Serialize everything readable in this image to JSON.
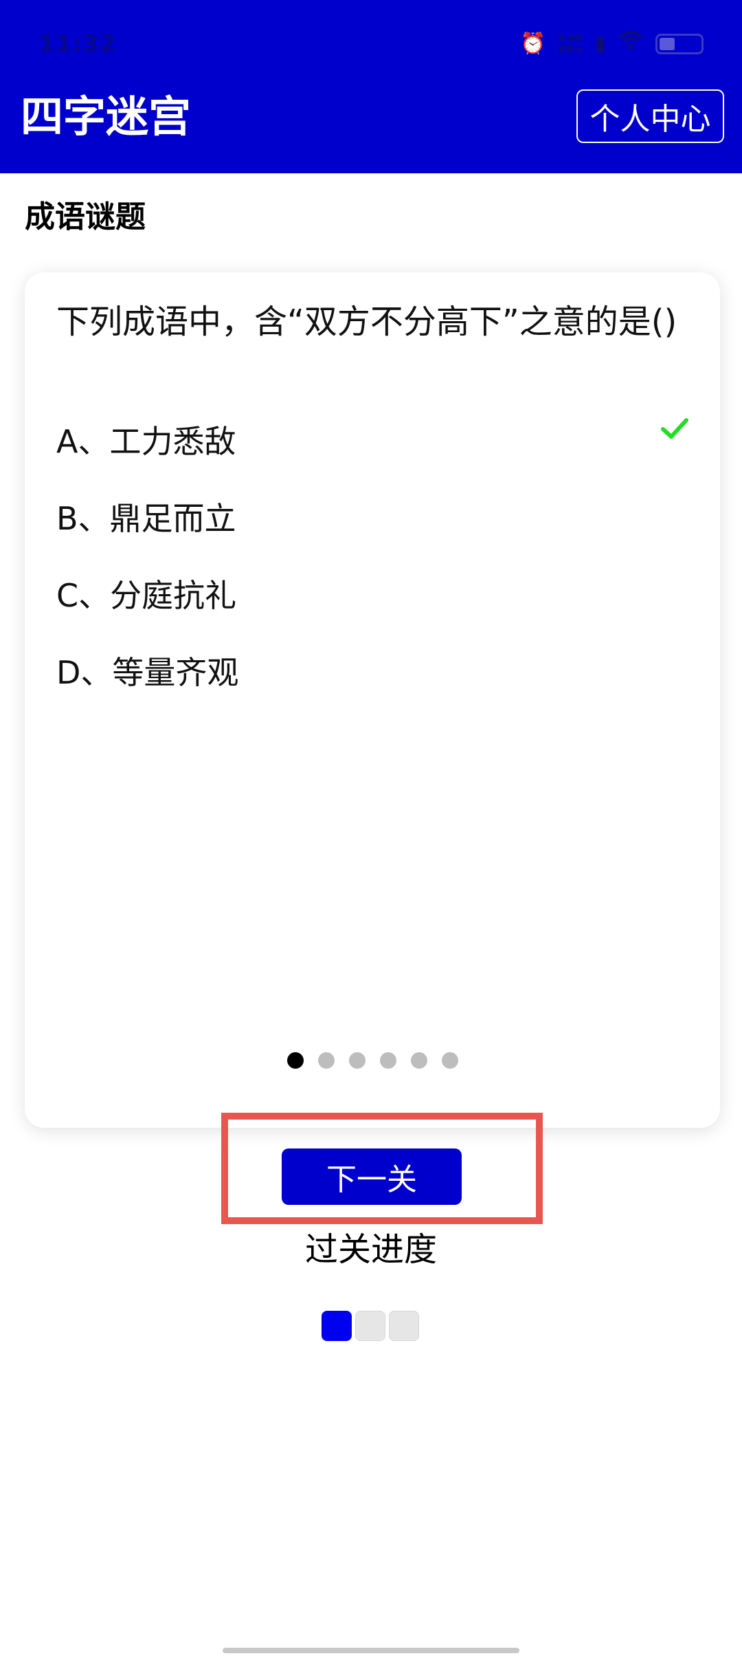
{
  "status_bar": {
    "time": "11:32",
    "net_speed": "0.90",
    "net_unit": "KB/s"
  },
  "header": {
    "title": "四字迷宫",
    "profile_label": "个人中心"
  },
  "section": {
    "title": "成语谜题"
  },
  "quiz": {
    "question": "下列成语中，含“双方不分高下”之意的是()",
    "options": [
      {
        "label": "A、工力悉敌",
        "correct": true
      },
      {
        "label": "B、鼎足而立"
      },
      {
        "label": "C、分庭抗礼"
      },
      {
        "label": "D、等量齐观"
      }
    ],
    "page_total": 6,
    "page_current": 1
  },
  "actions": {
    "next_label": "下一关"
  },
  "progress": {
    "label": "过关进度",
    "completed": 1,
    "total": 3
  },
  "colors": {
    "primary": "#0000CC",
    "check": "#22DD22",
    "highlight": "#E8574F"
  }
}
